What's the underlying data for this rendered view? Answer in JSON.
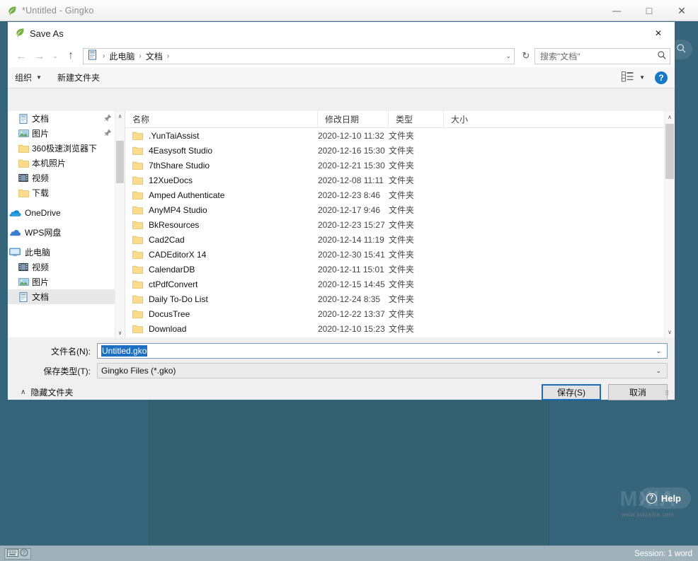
{
  "app": {
    "title": "*Untitled - Gingko",
    "icon": "gingko-leaf-icon",
    "window_buttons": {
      "minimize": "—",
      "maximize": "□",
      "close": "✕"
    },
    "help_button": {
      "label": "Help",
      "icon": "question-circle-icon"
    },
    "watermark": {
      "text": "MXIA",
      "sub": "www.xiazaiba.com"
    },
    "statusbar": {
      "left_icons": [
        "keyboard-icon",
        "question-circle-icon"
      ],
      "session": "Session: 1 word"
    },
    "search_icon": "search-icon"
  },
  "dialog": {
    "title": "Save As",
    "icon": "gingko-leaf-icon",
    "close_label": "✕",
    "nav": {
      "back": "←",
      "forward": "→",
      "history_caret": "⌄",
      "up": "↑",
      "refresh": "↻",
      "breadcrumb_icon": "documents-folder-icon",
      "breadcrumb": [
        "此电脑",
        "文档"
      ],
      "breadcrumb_sep": "›",
      "breadcrumb_caret": "⌄"
    },
    "search": {
      "placeholder": "搜索\"文档\"",
      "icon": "search-icon"
    },
    "toolbar": {
      "organize_label": "组织",
      "organize_caret": "▼",
      "new_folder_label": "新建文件夹",
      "view_icon": "list-view-icon",
      "view_caret": "▼",
      "help_label": "?"
    },
    "sidebar": {
      "items": [
        {
          "label": "文档",
          "icon": "documents-icon",
          "indent": 2,
          "pinned": true,
          "selected": false
        },
        {
          "label": "图片",
          "icon": "pictures-icon",
          "indent": 2,
          "pinned": true,
          "selected": false
        },
        {
          "label": "360极速浏览器下",
          "icon": "folder-icon",
          "indent": 2,
          "pinned": false,
          "selected": false
        },
        {
          "label": "本机照片",
          "icon": "folder-icon",
          "indent": 2,
          "pinned": false,
          "selected": false
        },
        {
          "label": "视频",
          "icon": "videos-icon",
          "indent": 2,
          "pinned": false,
          "selected": false
        },
        {
          "label": "下载",
          "icon": "folder-icon",
          "indent": 2,
          "pinned": false,
          "selected": false
        },
        {
          "label": "OneDrive",
          "icon": "onedrive-icon",
          "indent": 1,
          "pinned": false,
          "selected": false
        },
        {
          "label": "WPS网盘",
          "icon": "wps-cloud-icon",
          "indent": 1,
          "pinned": false,
          "selected": false
        },
        {
          "label": "此电脑",
          "icon": "this-pc-icon",
          "indent": 1,
          "pinned": false,
          "selected": false
        },
        {
          "label": "视频",
          "icon": "videos-icon",
          "indent": 2,
          "pinned": false,
          "selected": false
        },
        {
          "label": "图片",
          "icon": "pictures-icon",
          "indent": 2,
          "pinned": false,
          "selected": false
        },
        {
          "label": "文档",
          "icon": "documents-icon",
          "indent": 2,
          "pinned": false,
          "selected": true
        }
      ],
      "scroll_up": "∧",
      "scroll_down": "∨"
    },
    "file_list": {
      "columns": [
        "名称",
        "修改日期",
        "类型",
        "大小"
      ],
      "sort_caret": "⌃",
      "rows": [
        {
          "name": ".YunTaiAssist",
          "date": "2020-12-10 11:32",
          "type": "文件夹",
          "size": ""
        },
        {
          "name": "4Easysoft Studio",
          "date": "2020-12-16 15:30",
          "type": "文件夹",
          "size": ""
        },
        {
          "name": "7thShare Studio",
          "date": "2020-12-21 15:30",
          "type": "文件夹",
          "size": ""
        },
        {
          "name": "12XueDocs",
          "date": "2020-12-08 11:11",
          "type": "文件夹",
          "size": ""
        },
        {
          "name": "Amped Authenticate",
          "date": "2020-12-23 8:46",
          "type": "文件夹",
          "size": ""
        },
        {
          "name": "AnyMP4 Studio",
          "date": "2020-12-17 9:46",
          "type": "文件夹",
          "size": ""
        },
        {
          "name": "BkResources",
          "date": "2020-12-23 15:27",
          "type": "文件夹",
          "size": ""
        },
        {
          "name": "Cad2Cad",
          "date": "2020-12-14 11:19",
          "type": "文件夹",
          "size": ""
        },
        {
          "name": "CADEditorX 14",
          "date": "2020-12-30 15:41",
          "type": "文件夹",
          "size": ""
        },
        {
          "name": "CalendarDB",
          "date": "2020-12-11 15:01",
          "type": "文件夹",
          "size": ""
        },
        {
          "name": "ctPdfConvert",
          "date": "2020-12-15 14:45",
          "type": "文件夹",
          "size": ""
        },
        {
          "name": "Daily To-Do List",
          "date": "2020-12-24 8:35",
          "type": "文件夹",
          "size": ""
        },
        {
          "name": "DocusTree",
          "date": "2020-12-22 13:37",
          "type": "文件夹",
          "size": ""
        },
        {
          "name": "Download",
          "date": "2020-12-10 15:23",
          "type": "文件夹",
          "size": ""
        }
      ],
      "scroll_up": "∧",
      "scroll_down": "∨"
    },
    "fields": {
      "filename_label": "文件名(N):",
      "filename_value": "Untitled.gko",
      "filetype_label": "保存类型(T):",
      "filetype_value": "Gingko Files (*.gko)",
      "caret": "⌄"
    },
    "footer": {
      "hide_folders_label": "隐藏文件夹",
      "hide_folders_caret": "∧",
      "save_label": "保存(S)",
      "cancel_label": "取消"
    }
  }
}
